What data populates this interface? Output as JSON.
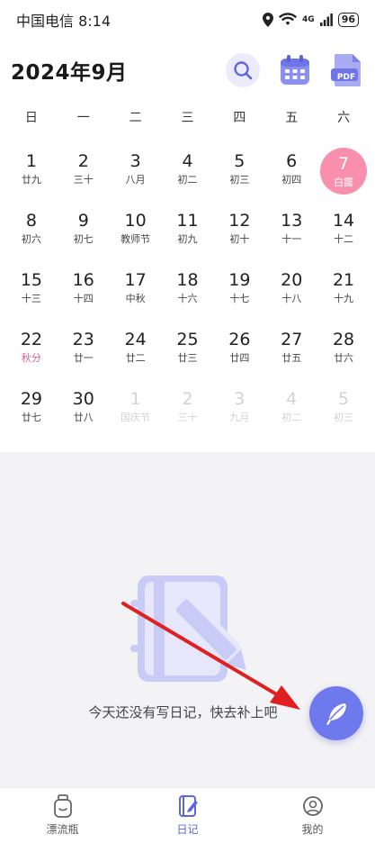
{
  "status_bar": {
    "carrier_time": "中国电信 8:14",
    "network": "4G",
    "battery": "96"
  },
  "header": {
    "title": "2024年9月",
    "icons": [
      "search-icon",
      "calendar-icon",
      "pdf-icon"
    ],
    "pdf_label": "PDF"
  },
  "weekdays": [
    "日",
    "一",
    "二",
    "三",
    "四",
    "五",
    "六"
  ],
  "days": [
    {
      "num": "1",
      "lunar": "廿九"
    },
    {
      "num": "2",
      "lunar": "三十"
    },
    {
      "num": "3",
      "lunar": "八月"
    },
    {
      "num": "4",
      "lunar": "初二"
    },
    {
      "num": "5",
      "lunar": "初三"
    },
    {
      "num": "6",
      "lunar": "初四"
    },
    {
      "num": "7",
      "lunar": "白露",
      "selected": true
    },
    {
      "num": "8",
      "lunar": "初六"
    },
    {
      "num": "9",
      "lunar": "初七"
    },
    {
      "num": "10",
      "lunar": "教师节"
    },
    {
      "num": "11",
      "lunar": "初九"
    },
    {
      "num": "12",
      "lunar": "初十"
    },
    {
      "num": "13",
      "lunar": "十一"
    },
    {
      "num": "14",
      "lunar": "十二"
    },
    {
      "num": "15",
      "lunar": "十三"
    },
    {
      "num": "16",
      "lunar": "十四"
    },
    {
      "num": "17",
      "lunar": "中秋"
    },
    {
      "num": "18",
      "lunar": "十六"
    },
    {
      "num": "19",
      "lunar": "十七"
    },
    {
      "num": "20",
      "lunar": "十八"
    },
    {
      "num": "21",
      "lunar": "十九"
    },
    {
      "num": "22",
      "lunar": "秋分",
      "festival": true
    },
    {
      "num": "23",
      "lunar": "廿一"
    },
    {
      "num": "24",
      "lunar": "廿二"
    },
    {
      "num": "25",
      "lunar": "廿三"
    },
    {
      "num": "26",
      "lunar": "廿四"
    },
    {
      "num": "27",
      "lunar": "廿五"
    },
    {
      "num": "28",
      "lunar": "廿六"
    },
    {
      "num": "29",
      "lunar": "廿七"
    },
    {
      "num": "30",
      "lunar": "廿八"
    },
    {
      "num": "1",
      "lunar": "国庆节",
      "faded": true
    },
    {
      "num": "2",
      "lunar": "三十",
      "faded": true
    },
    {
      "num": "3",
      "lunar": "九月",
      "faded": true
    },
    {
      "num": "4",
      "lunar": "初二",
      "faded": true
    },
    {
      "num": "5",
      "lunar": "初三",
      "faded": true
    }
  ],
  "diary": {
    "empty_message": "今天还没有写日记，快去补上吧",
    "fab_icon": "feather-icon"
  },
  "tabs": [
    {
      "label": "漂流瓶",
      "icon": "bottle-icon"
    },
    {
      "label": "日记",
      "icon": "diary-icon",
      "active": true
    },
    {
      "label": "我的",
      "icon": "profile-icon"
    }
  ],
  "colors": {
    "accent": "#6f79ee",
    "selected_day": "#f78fad",
    "festival": "#e0608a",
    "annotation_arrow": "#e02020"
  }
}
